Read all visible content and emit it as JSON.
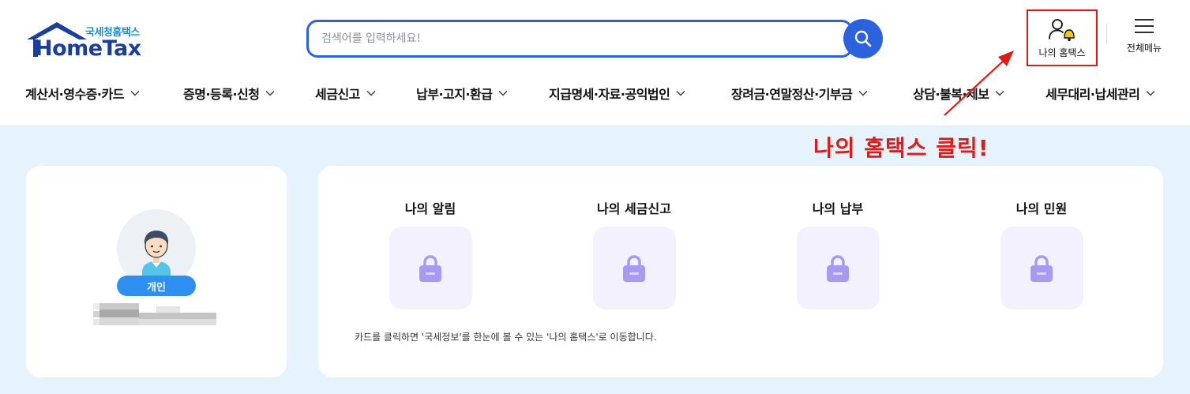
{
  "logo": {
    "small": "국세청홈택스",
    "big": "HomeTax"
  },
  "search": {
    "placeholder": "검색어를 입력하세요!"
  },
  "utility": {
    "my_hometax_label": "나의 홈택스",
    "all_menu_label": "전체메뉴"
  },
  "gnb": [
    {
      "label": "계산서·영수증·카드"
    },
    {
      "label": "증명·등록·신청"
    },
    {
      "label": "세금신고"
    },
    {
      "label": "납부·고지·환급"
    },
    {
      "label": "지급명세·자료·공익법인"
    },
    {
      "label": "장려금·연말정산·기부금"
    },
    {
      "label": "상담·불복·제보"
    },
    {
      "label": "세무대리·납세관리"
    }
  ],
  "annotation": {
    "text": "나의 홈택스 클릭!",
    "color": "#e01919"
  },
  "profile": {
    "badge": "개인"
  },
  "features": [
    {
      "title": "나의 알림",
      "icon": "lock-icon"
    },
    {
      "title": "나의 세금신고",
      "icon": "lock-icon"
    },
    {
      "title": "나의 납부",
      "icon": "lock-icon"
    },
    {
      "title": "나의 민원",
      "icon": "lock-icon"
    }
  ],
  "features_note": "카드를 클릭하면 '국세정보'를 한눈에 볼 수 있는 '나의 홈택스'로 이동합니다.",
  "colors": {
    "brand_blue": "#2b62dd",
    "logo_navy": "#1b3e9b",
    "badge_blue": "#2d8ff2",
    "bg_light": "#e7f3fc",
    "lock_purple": "#a89af0"
  }
}
